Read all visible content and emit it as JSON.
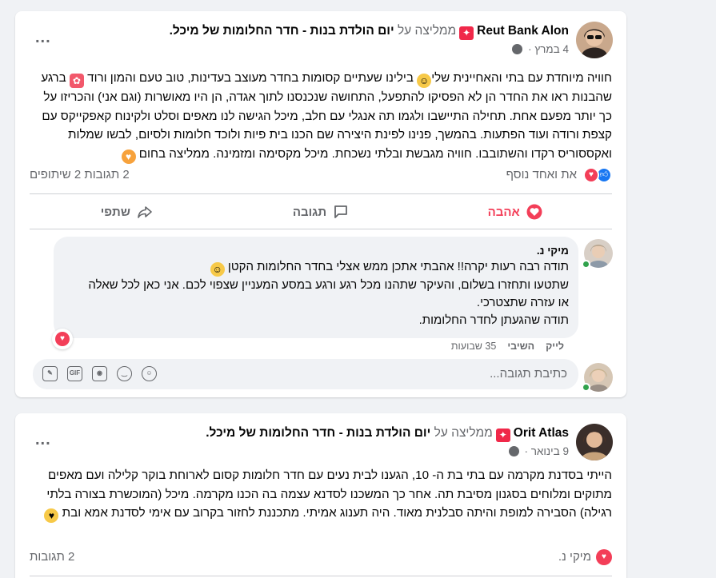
{
  "post1": {
    "author": "Reut Bank Alon",
    "recommends_text": "ממליצה על",
    "page_name": "יום הולדת בנות - חדר החלומות של מיכל.",
    "date": "4 במרץ · ",
    "more_label": "...",
    "text_parts": [
      "חוויה מיוחדת עם בתי והאחיינית שלי",
      " בילינו שעתיים קסומות בחדר מעוצב בעדינות, טוב טעם והמון ורוד ",
      " ברגע שהבנות ראו את החדר הן לא הפסיקו להתפעל, התחושה שנכנסנו לתוך אגדה, הן היו מאושרות (וגם אני) והכריזו על כך יותר מפעם אחת. תחילה התיישבו ולגמו תה אנגלי עם חלב, מיכל הגישה לנו מאפים וסלט ולקינוח קאפקייקס עם קצפת ורודה ועוד הפתעות. בהמשך, פנינו לפינת היצירה שם הכנו בית פיות ולוכד חלומות ולסיום, לבשו שמלות ואקססוריס רקדו והשתובבו. חוויה מגבשת ובלתי נשכחת. מיכל מקסימה ומזמינה. ממליצה בחום "
    ],
    "reactions_names": "את ואחד נוסף",
    "reactions_stats": "2 תגובות  2 שיתופים",
    "actions": {
      "love": "אהבה",
      "comment": "תגובה",
      "share": "שתפי"
    },
    "comment": {
      "author": "מיקי נ.",
      "lines": [
        "תודה רבה רעות יקרה!! אהבתי אתכן ממש אצלי בחדר החלומות הקטן",
        "שתטעו ותחזרו בשלום, והעיקר שתהנו מכל רגע ורגע במסע המעניין שצפוי לכם. אני כאן לכל שאלה",
        "או עזרה שתצטרכי.",
        "תודה שהגעתן לחדר החלומות."
      ],
      "like": "לייק",
      "reply": "השיבי",
      "age": "35 שבועות"
    },
    "reply_placeholder": "כתיבת תגובה...",
    "tools": [
      "sticker-icon",
      "gif-icon",
      "camera-icon",
      "emoji-icon",
      "avatar-sticker-icon"
    ]
  },
  "post2": {
    "author": "Orit Atlas",
    "recommends_text": "ממליצה על",
    "page_name": "יום הולדת בנות - חדר החלומות של מיכל.",
    "date": "9 בינואר · ",
    "more_label": "...",
    "text": "הייתי בסדנת מקרמה עם בתי בת ה- 10, הגענו לבית נעים עם חדר חלומות קסום לארוחת בוקר קלילה ועם מאפים מתוקים ומלוחים בסגנון מסיבת תה. אחר כך המשכנו לסדנא עצמה בה הכנו מקרמה. מיכל (המוכשרת בצורה בלתי רגילה) הסבירה למופת והיתה סבלנית מאוד. היה תענוג אמיתי. מתכננת לחזור בקרוב עם אימי לסדנת אמא ובת ",
    "reactions_name": "מיקי נ.",
    "comments_count": "2 תגובות"
  },
  "colors": {
    "love": "#f33e58",
    "like": "#1877f2",
    "muted": "#65676b",
    "online": "#31a24c"
  }
}
